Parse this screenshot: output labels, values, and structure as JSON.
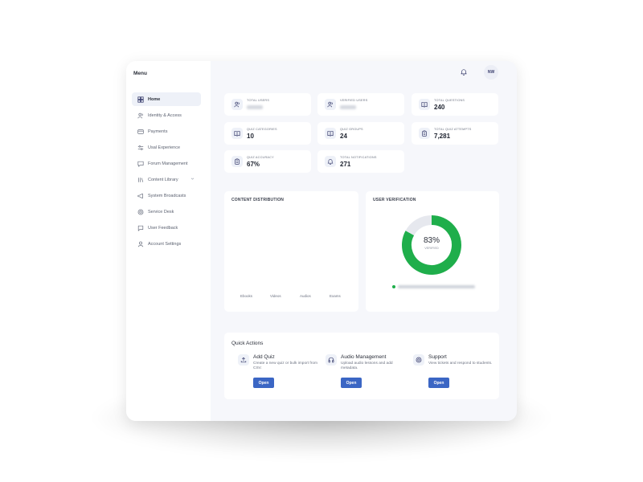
{
  "sidebar": {
    "title": "Menu",
    "items": [
      {
        "label": "Home",
        "icon": "home-icon",
        "active": true
      },
      {
        "label": "Identity & Access",
        "icon": "users-icon"
      },
      {
        "label": "Payments",
        "icon": "card-icon"
      },
      {
        "label": "Usal Experience",
        "icon": "sliders-icon"
      },
      {
        "label": "Forum Management",
        "icon": "chat-icon"
      },
      {
        "label": "Content Library",
        "icon": "library-icon",
        "has_chevron": true
      },
      {
        "label": "System Broadcasts",
        "icon": "megaphone-icon"
      },
      {
        "label": "Service Desk",
        "icon": "lifebuoy-icon"
      },
      {
        "label": "User Feedback",
        "icon": "message-icon"
      },
      {
        "label": "Account Settings",
        "icon": "user-icon"
      }
    ]
  },
  "header": {
    "avatar_initials": "NW",
    "bell_icon": "bell-icon"
  },
  "stats": [
    {
      "label": "TOTAL USERS",
      "value": "",
      "icon": "users-icon",
      "blurred": true
    },
    {
      "label": "VERIFIED USERS",
      "value": "",
      "icon": "users-icon",
      "blurred": true
    },
    {
      "label": "TOTAL QUESTIONS",
      "value": "240",
      "icon": "book-icon"
    },
    {
      "label": "QUIZ CATEGORIES",
      "value": "10",
      "icon": "book-icon"
    },
    {
      "label": "QUIZ GROUPS",
      "value": "24",
      "icon": "book-icon"
    },
    {
      "label": "TOTAL QUIZ ATTEMPTS",
      "value": "7,281",
      "icon": "clipboard-icon"
    },
    {
      "label": "QUIZ ACCURACY",
      "value": "67%",
      "icon": "clipboard-icon"
    },
    {
      "label": "TOTAL NOTIFICATIONS",
      "value": "271",
      "icon": "bell-icon"
    }
  ],
  "content_distribution": {
    "title": "CONTENT DISTRIBUTION",
    "categories": [
      "Ebooks",
      "Videos",
      "Audios",
      "Exams"
    ]
  },
  "user_verification": {
    "title": "USER VERIFICATION",
    "center_value": "83%",
    "center_label": "VERIFIED",
    "verified_color": "#1fae4b",
    "unverified_color": "#e6e8ee"
  },
  "chart_data": {
    "type": "pie",
    "title": "USER VERIFICATION",
    "values": [
      83,
      17
    ],
    "center_label": "83% VERIFIED"
  },
  "quick_actions": {
    "title": "Quick Actions",
    "items": [
      {
        "name": "Add Quiz",
        "desc": "Create a new quiz or bulk import from CSV.",
        "button": "Open",
        "icon": "upload-icon"
      },
      {
        "name": "Audio Management",
        "desc": "Upload audio lessons and add metadata.",
        "button": "Open",
        "icon": "headphones-icon"
      },
      {
        "name": "Support",
        "desc": "View tickets and respond to students.",
        "button": "Open",
        "icon": "lifebuoy-icon"
      }
    ]
  },
  "colors": {
    "accent": "#3b66c4",
    "success": "#1fae4b"
  }
}
